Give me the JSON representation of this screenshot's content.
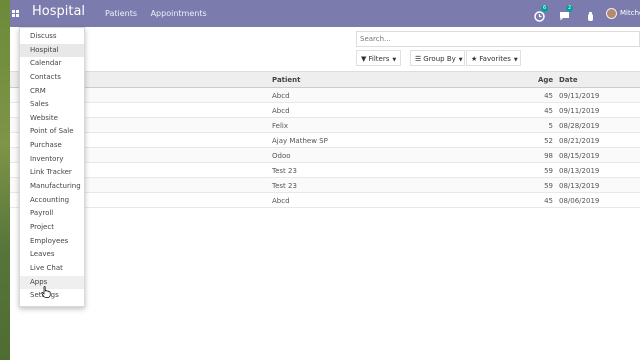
{
  "navbar": {
    "brand": "Hospital",
    "menu": [
      "Patients",
      "Appointments"
    ],
    "activity_badge": "6",
    "messages_badge": "2",
    "user_name": "Mitchell Admin",
    "color": "#7c7bad"
  },
  "search": {
    "placeholder": "Search..."
  },
  "filters": {
    "filters_label": "Filters",
    "groupby_label": "Group By",
    "favorites_label": "Favorites"
  },
  "list": {
    "headers": {
      "patient": "Patient",
      "age": "Age",
      "date": "Date"
    },
    "rows": [
      {
        "patient": "Abcd",
        "age": "45",
        "date": "09/11/2019"
      },
      {
        "patient": "Abcd",
        "age": "45",
        "date": "09/11/2019"
      },
      {
        "patient": "Felix",
        "age": "5",
        "date": "08/28/2019"
      },
      {
        "patient": "Ajay Mathew SP",
        "age": "52",
        "date": "08/21/2019"
      },
      {
        "patient": "Odoo",
        "age": "98",
        "date": "08/15/2019"
      },
      {
        "patient": "Test 23",
        "age": "59",
        "date": "08/13/2019"
      },
      {
        "patient": "Test 23",
        "age": "59",
        "date": "08/13/2019"
      },
      {
        "patient": "Abcd",
        "age": "45",
        "date": "08/06/2019"
      }
    ]
  },
  "app_menu": {
    "items": [
      "Discuss",
      "Hospital",
      "Calendar",
      "Contacts",
      "CRM",
      "Sales",
      "Website",
      "Point of Sale",
      "Purchase",
      "Inventory",
      "Link Tracker",
      "Manufacturing",
      "Accounting",
      "Payroll",
      "Project",
      "Employees",
      "Leaves",
      "Live Chat",
      "Apps",
      "Settings"
    ],
    "active": "Hospital",
    "hovered": "Apps"
  }
}
